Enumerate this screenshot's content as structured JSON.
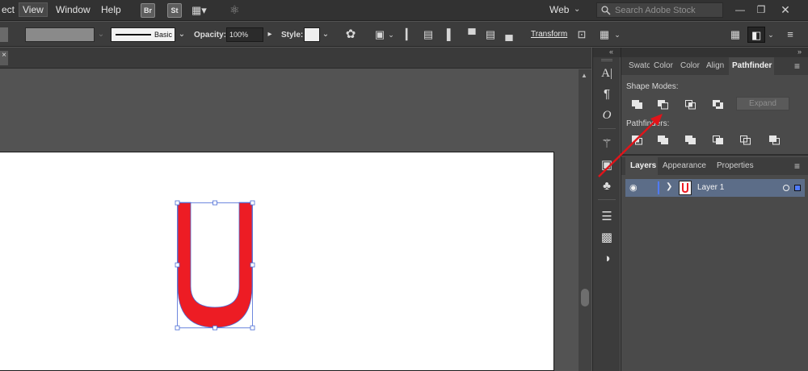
{
  "menubar": {
    "items": [
      "ect",
      "View",
      "Window",
      "Help"
    ],
    "bridge": "Br",
    "stock": "St",
    "workspace": "Web",
    "search_placeholder": "Search Adobe Stock"
  },
  "controlbar": {
    "stroke_style": "Basic",
    "opacity_label": "Opacity:",
    "opacity_value": "100%",
    "style_label": "Style:",
    "transform": "Transform"
  },
  "pathfinder_panel": {
    "tabs": [
      "Swatc",
      "Color",
      "Color",
      "Align",
      "Pathfinder"
    ],
    "shape_modes_label": "Shape Modes:",
    "pathfinders_label": "Pathfinders:",
    "expand": "Expand"
  },
  "layers_panel": {
    "tabs": [
      "Layers",
      "Appearance",
      "Properties"
    ],
    "layer_name": "Layer 1"
  },
  "artwork": {
    "fill_color": "#ed1c24",
    "selection_color": "#4a6bd6"
  },
  "annotation": {
    "arrow_color": "#e0141a"
  }
}
